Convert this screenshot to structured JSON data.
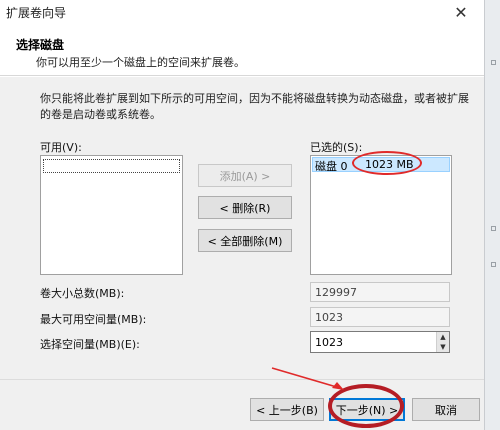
{
  "window": {
    "title": "扩展卷向导",
    "close_glyph": "✕"
  },
  "header": {
    "title": "选择磁盘",
    "subtitle": "你可以用至少一个磁盘上的空间来扩展卷。"
  },
  "description": "你只能将此卷扩展到如下所示的可用空间，因为不能将磁盘转换为动态磁盘，或者被扩展的卷是启动卷或系统卷。",
  "available": {
    "label": "可用(V):",
    "items": []
  },
  "selected": {
    "label": "已选的(S):",
    "items": [
      {
        "name": "磁盘 0",
        "size": "1023 MB"
      }
    ]
  },
  "buttons": {
    "add": "添加(A) >",
    "remove": "< 删除(R)",
    "remove_all": "< 全部删除(M)"
  },
  "fields": {
    "total_size_label": "卷大小总数(MB):",
    "total_size_value": "129997",
    "max_space_label": "最大可用空间量(MB):",
    "max_space_value": "1023",
    "select_space_label": "选择空间量(MB)(E):",
    "select_space_value": "1023"
  },
  "footer": {
    "back": "< 上一步(B)",
    "next": "下一步(N) >",
    "cancel": "取消"
  },
  "colors": {
    "selection": "#cce8ff",
    "primary_border": "#0078d7",
    "annotation_red": "#e02a2a"
  }
}
